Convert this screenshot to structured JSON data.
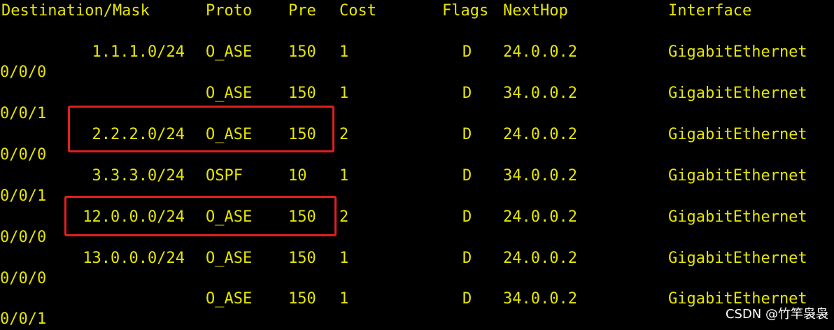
{
  "header": {
    "destination_mask": "Destination/Mask",
    "proto": "Proto",
    "pre": "Pre",
    "cost": "Cost",
    "flags": "Flags",
    "nexthop": "NextHop",
    "interface": "Interface"
  },
  "routes": [
    {
      "destination": "1.1.1.0/24",
      "proto": "O_ASE",
      "pre": "150",
      "cost": "1",
      "flags": "D",
      "nexthop": "24.0.0.2",
      "interface": "GigabitEthernet",
      "interface_cont": "0/0/0"
    },
    {
      "destination": "",
      "proto": "O_ASE",
      "pre": "150",
      "cost": "1",
      "flags": "D",
      "nexthop": "34.0.0.2",
      "interface": "GigabitEthernet",
      "interface_cont": "0/0/1"
    },
    {
      "destination": "2.2.2.0/24",
      "proto": "O_ASE",
      "pre": "150",
      "cost": "2",
      "flags": "D",
      "nexthop": "24.0.0.2",
      "interface": "GigabitEthernet",
      "interface_cont": "0/0/0"
    },
    {
      "destination": "3.3.3.0/24",
      "proto": "OSPF",
      "pre": "10",
      "cost": "1",
      "flags": "D",
      "nexthop": "34.0.0.2",
      "interface": "GigabitEthernet",
      "interface_cont": "0/0/1"
    },
    {
      "destination": "12.0.0.0/24",
      "proto": "O_ASE",
      "pre": "150",
      "cost": "2",
      "flags": "D",
      "nexthop": "24.0.0.2",
      "interface": "GigabitEthernet",
      "interface_cont": "0/0/0"
    },
    {
      "destination": "13.0.0.0/24",
      "proto": "O_ASE",
      "pre": "150",
      "cost": "1",
      "flags": "D",
      "nexthop": "24.0.0.2",
      "interface": "GigabitEthernet",
      "interface_cont": "0/0/0"
    },
    {
      "destination": "",
      "proto": "O_ASE",
      "pre": "150",
      "cost": "1",
      "flags": "D",
      "nexthop": "34.0.0.2",
      "interface": "GigabitEthernet",
      "interface_cont": "0/0/1"
    }
  ],
  "watermark": "CSDN @竹竿袅袅",
  "colors": {
    "background": "#000000",
    "text": "#e6e600",
    "highlight_box": "#e02020",
    "watermark": "#ffffff"
  }
}
